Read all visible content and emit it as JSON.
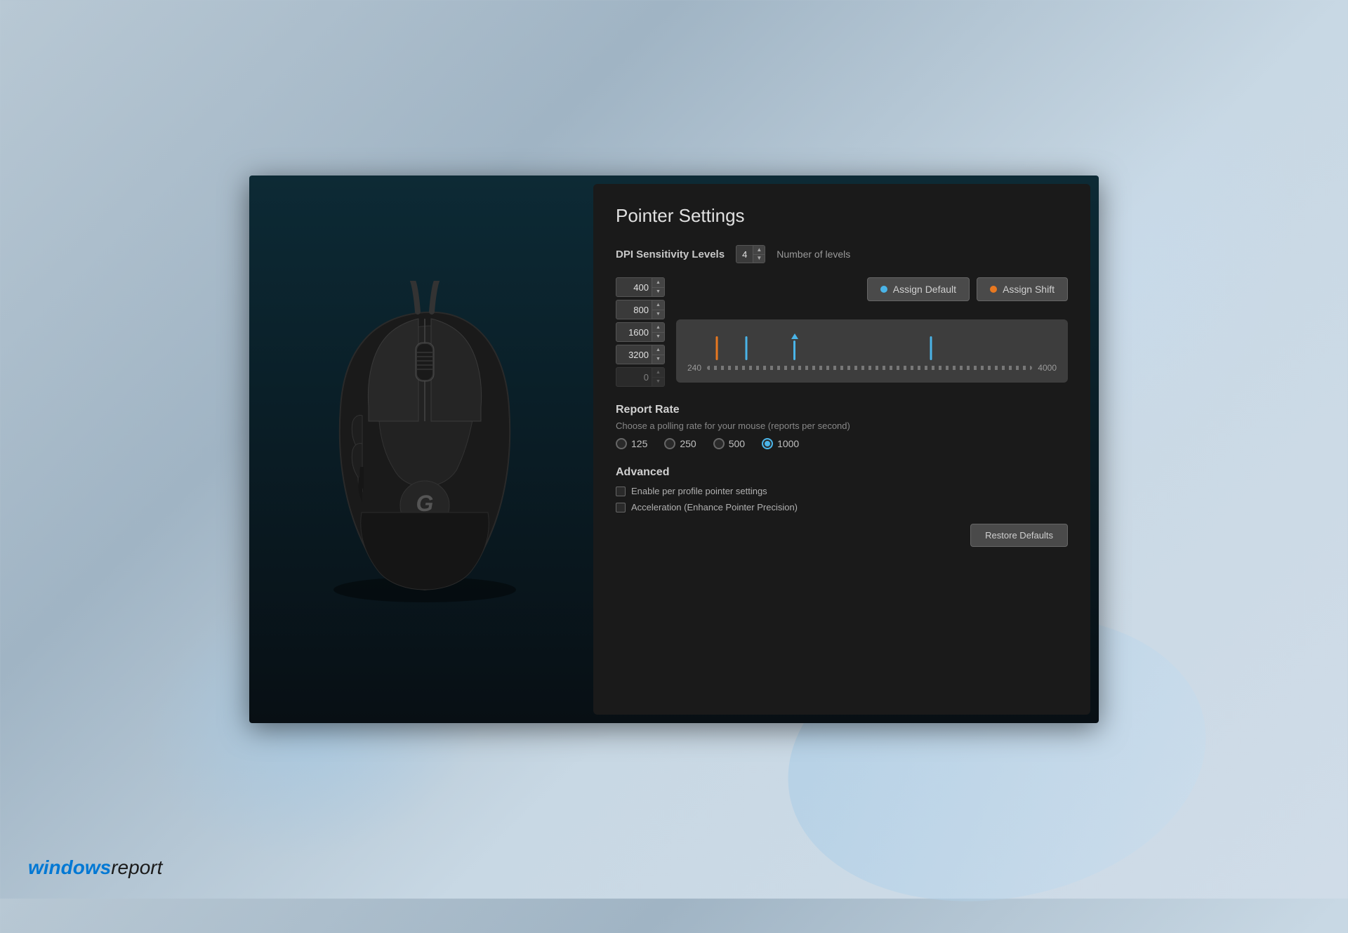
{
  "background": {
    "watermark_windows": "windows",
    "watermark_report": "report"
  },
  "app": {
    "title": "Pointer Settings",
    "dpi_section": {
      "label": "DPI Sensitivity Levels",
      "num_levels_value": "4",
      "num_levels_label": "Number of levels",
      "dpi_rows": [
        {
          "value": "400",
          "disabled": false
        },
        {
          "value": "800",
          "disabled": false
        },
        {
          "value": "1600",
          "disabled": false
        },
        {
          "value": "3200",
          "disabled": false
        },
        {
          "value": "0",
          "disabled": true
        }
      ],
      "assign_default_label": "Assign Default",
      "assign_shift_label": "Assign Shift",
      "chart_min": "240",
      "chart_max": "4000",
      "markers": [
        {
          "pct": 8,
          "color": "#e87820",
          "is_up": false
        },
        {
          "pct": 16,
          "color": "#4ab4e8",
          "is_up": false
        },
        {
          "pct": 29,
          "color": "#4ab4e8",
          "is_up": true
        },
        {
          "pct": 66,
          "color": "#4ab4e8",
          "is_up": false
        }
      ]
    },
    "report_rate": {
      "title": "Report Rate",
      "description": "Choose a polling rate for your mouse (reports per second)",
      "options": [
        {
          "value": "125",
          "selected": false
        },
        {
          "value": "250",
          "selected": false
        },
        {
          "value": "500",
          "selected": false
        },
        {
          "value": "1000",
          "selected": true
        }
      ]
    },
    "advanced": {
      "title": "Advanced",
      "checkboxes": [
        {
          "label": "Enable per profile pointer settings",
          "checked": false
        },
        {
          "label": "Acceleration (Enhance Pointer Precision)",
          "checked": false
        }
      ],
      "restore_button_label": "Restore Defaults"
    }
  }
}
